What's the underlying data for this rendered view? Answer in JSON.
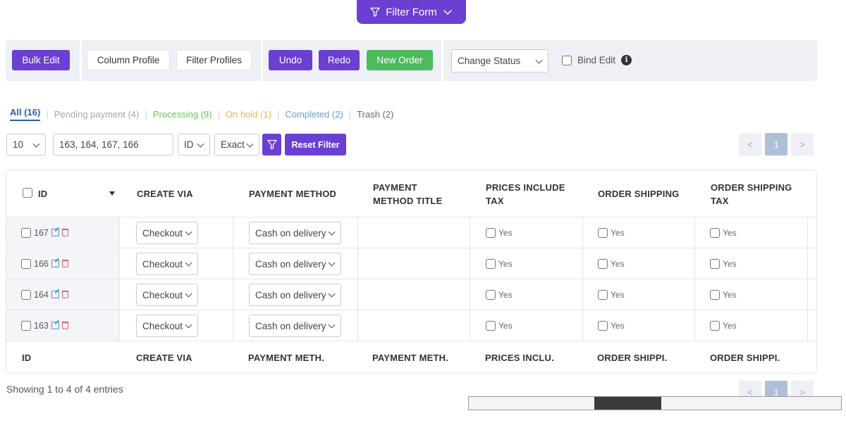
{
  "filter_form": {
    "label": "Filter Form"
  },
  "toolbar": {
    "bulk_edit": "Bulk Edit",
    "column_profile": "Column Profile",
    "filter_profiles": "Filter Profiles",
    "undo": "Undo",
    "redo": "Redo",
    "new_order": "New Order",
    "change_status": "Change Status",
    "bind_edit": "Bind Edit"
  },
  "status_tabs": {
    "all": "All (16)",
    "pending": "Pending payment (4)",
    "processing": "Processing (9)",
    "on_hold": "On hold (1)",
    "completed": "Completed (2)",
    "trash": "Trash (2)"
  },
  "filters": {
    "per_page": "10",
    "search_value": "163, 164, 167, 166",
    "field": "ID",
    "match": "Exact",
    "reset": "Reset Filter"
  },
  "pagination": {
    "prev": "<",
    "page": "1",
    "next": ">"
  },
  "table": {
    "headers": {
      "id": "ID",
      "create_via": "CREATE VIA",
      "payment_method": "PAYMENT METHOD",
      "payment_method_title_1": "PAYMENT",
      "payment_method_title_2": "METHOD TITLE",
      "prices_include_tax_1": "PRICES INCLUDE",
      "prices_include_tax_2": "TAX",
      "order_shipping": "ORDER SHIPPING",
      "order_shipping_tax_1": "ORDER SHIPPING",
      "order_shipping_tax_2": "TAX"
    },
    "rows": [
      {
        "id": "167",
        "create_via": "Checkout",
        "payment_method": "Cash on delivery",
        "prices_include_tax": "Yes",
        "order_shipping": "Yes",
        "order_shipping_tax": "Yes"
      },
      {
        "id": "166",
        "create_via": "Checkout",
        "payment_method": "Cash on delivery",
        "prices_include_tax": "Yes",
        "order_shipping": "Yes",
        "order_shipping_tax": "Yes"
      },
      {
        "id": "164",
        "create_via": "Checkout",
        "payment_method": "Cash on delivery",
        "prices_include_tax": "Yes",
        "order_shipping": "Yes",
        "order_shipping_tax": "Yes"
      },
      {
        "id": "163",
        "create_via": "Checkout",
        "payment_method": "Cash on delivery",
        "prices_include_tax": "Yes",
        "order_shipping": "Yes",
        "order_shipping_tax": "Yes"
      }
    ],
    "footers": {
      "id": "ID",
      "create_via": "CREATE VIA",
      "payment_method": "PAYMENT METH.",
      "payment_method_title": "PAYMENT METH.",
      "prices_include": "PRICES INCLU.",
      "order_shipping": "ORDER SHIPPI.",
      "order_shipping_tax": "ORDER SHIPPI."
    }
  },
  "showing": "Showing 1 to 4 of 4 entries",
  "colors": {
    "accent": "#6a3fd1",
    "green": "#4cbb5b"
  }
}
